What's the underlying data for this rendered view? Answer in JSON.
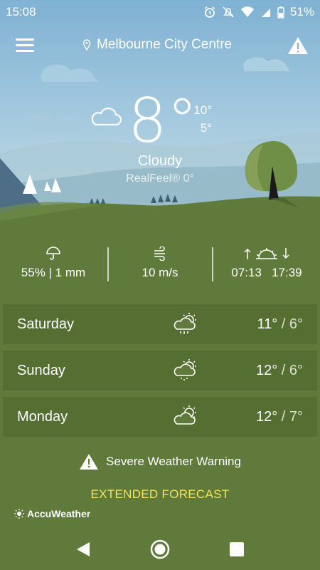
{
  "status_bar": {
    "time": "15:08",
    "battery": "51%"
  },
  "header": {
    "location": "Melbourne City Centre"
  },
  "current": {
    "temperature": "8°",
    "high": "10°",
    "low": "5°",
    "condition": "Cloudy",
    "realfeel": "RealFeel® 0°",
    "icon": "cloud-icon"
  },
  "stats": {
    "precipitation": "55% | 1 mm",
    "wind": "10 m/s",
    "sunrise": "07:13",
    "sunset": "17:39"
  },
  "forecast": [
    {
      "day": "Saturday",
      "high": "11°",
      "low": "/ 6°",
      "icon": "sun-cloud-rain-icon"
    },
    {
      "day": "Sunday",
      "high": "12°",
      "low": "/ 6°",
      "icon": "sun-cloud-drizzle-icon"
    },
    {
      "day": "Monday",
      "high": "12°",
      "low": "/ 7°",
      "icon": "sun-cloud-icon"
    }
  ],
  "warning": {
    "label": "Severe Weather Warning"
  },
  "extended": {
    "label": "EXTENDED FORECAST"
  },
  "brand": {
    "name": "AccuWeather"
  },
  "colors": {
    "ground": "#5f7a3b",
    "accent_yellow": "#f3e35a",
    "sky": "#9fc6dd"
  }
}
